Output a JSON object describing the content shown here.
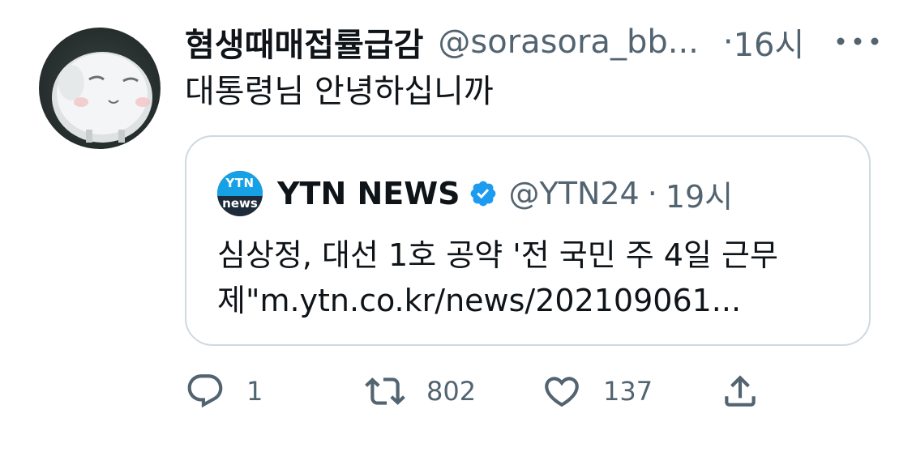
{
  "tweet": {
    "display_name": "혐생때매접률급감",
    "handle": "@sorasora_bb...",
    "separator": "·",
    "time": "16시",
    "text": "대통령님 안녕하십니까",
    "avatar_icon": "fluffy-creature-avatar",
    "more_icon": "more-dots-icon"
  },
  "quoted": {
    "avatar_label_top": "YTN",
    "avatar_label_bottom": "news",
    "display_name": "YTN NEWS",
    "verified_icon": "verified-badge-icon",
    "handle": "@YTN24",
    "separator": "·",
    "time": "19시",
    "text": "심상정, 대선 1호 공약 '전 국민 주 4일 근무제\"m.ytn.co.kr/news/202109061..."
  },
  "actions": {
    "reply": {
      "icon": "reply-icon",
      "count": "1"
    },
    "retweet": {
      "icon": "retweet-icon",
      "count": "802"
    },
    "like": {
      "icon": "heart-icon",
      "count": "137"
    },
    "share": {
      "icon": "share-icon"
    }
  },
  "colors": {
    "text_primary": "#0f1419",
    "text_secondary": "#536471",
    "border": "#cfd9de",
    "verified": "#1d9bf0",
    "ytn_blue": "#16a0e6"
  }
}
